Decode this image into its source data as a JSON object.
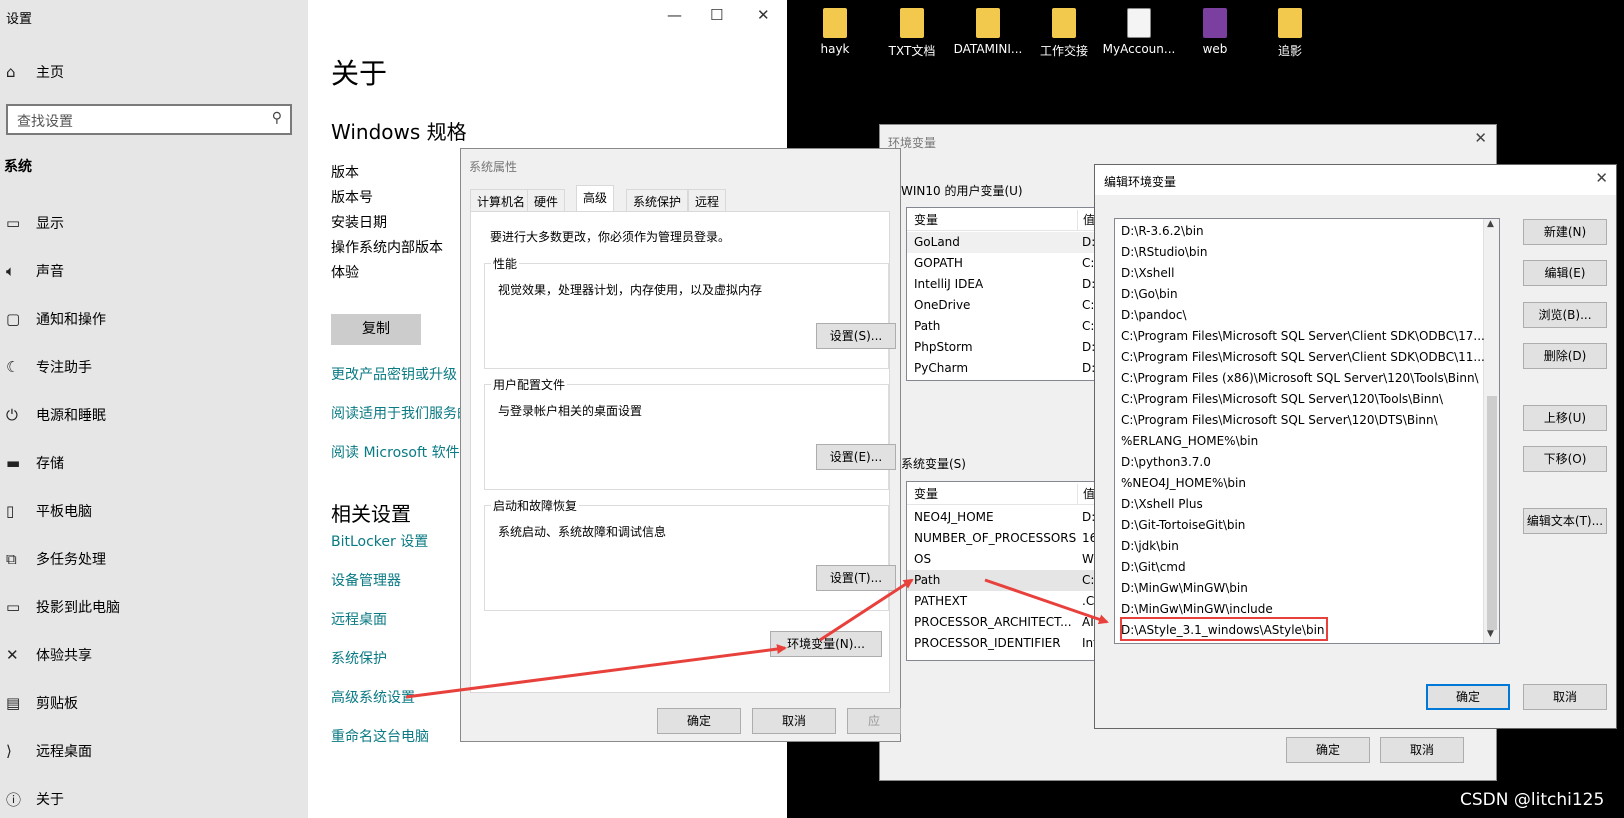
{
  "desktop": {
    "icons": [
      {
        "label": "hayk",
        "type": "folder"
      },
      {
        "label": "TXT文档",
        "type": "folder"
      },
      {
        "label": "DATAMINI...",
        "type": "folder"
      },
      {
        "label": "工作交接",
        "type": "folder"
      },
      {
        "label": "MyAccoun...",
        "type": "document"
      },
      {
        "label": "web",
        "type": "photoshop-file"
      },
      {
        "label": "追影",
        "type": "folder"
      }
    ],
    "watermark": "CSDN @litchi125"
  },
  "settings": {
    "window_title": "设置",
    "controls": {
      "minimize": "—",
      "maximize": "☐",
      "close": "✕"
    },
    "home": "主页",
    "search_placeholder": "查找设置",
    "section": "系统",
    "nav": [
      "显示",
      "声音",
      "通知和操作",
      "专注助手",
      "电源和睡眠",
      "存储",
      "平板电脑",
      "多任务处理",
      "投影到此电脑",
      "体验共享",
      "剪贴板",
      "远程桌面",
      "关于"
    ],
    "page_title": "关于",
    "spec_heading": "Windows 规格",
    "spec_labels": [
      "版本",
      "版本号",
      "安装日期",
      "操作系统内部版本",
      "体验"
    ],
    "copy_button": "复制",
    "links": [
      "更改产品密钥或升级",
      "阅读适用于我们服务的",
      "阅读 Microsoft 软件许"
    ],
    "related_heading": "相关设置",
    "related_links": [
      "BitLocker 设置",
      "设备管理器",
      "远程桌面",
      "系统保护",
      "高级系统设置",
      "重命名这台电脑"
    ]
  },
  "system_properties": {
    "title": "系统属性",
    "tabs": [
      "计算机名",
      "硬件",
      "高级",
      "系统保护",
      "远程"
    ],
    "active_tab": "高级",
    "admin_note": "要进行大多数更改，你必须作为管理员登录。",
    "performance": {
      "label": "性能",
      "desc": "视觉效果，处理器计划，内存使用，以及虚拟内存",
      "button": "设置(S)..."
    },
    "user_profiles": {
      "label": "用户配置文件",
      "desc": "与登录帐户相关的桌面设置",
      "button": "设置(E)..."
    },
    "startup": {
      "label": "启动和故障恢复",
      "desc": "系统启动、系统故障和调试信息",
      "button": "设置(T)..."
    },
    "env_button": "环境变量(N)...",
    "ok": "确定",
    "cancel": "取消",
    "apply": "应"
  },
  "env_vars": {
    "title": "环境变量",
    "user_group": "WIN10 的用户变量(U)",
    "header_var": "变量",
    "header_val": "值",
    "user_rows": [
      {
        "name": "GoLand",
        "value": "D:"
      },
      {
        "name": "GOPATH",
        "value": "C:\\"
      },
      {
        "name": "IntelliJ IDEA",
        "value": "D:"
      },
      {
        "name": "OneDrive",
        "value": "C:\\"
      },
      {
        "name": "Path",
        "value": "C:\\"
      },
      {
        "name": "PhpStorm",
        "value": "D:"
      },
      {
        "name": "PyCharm",
        "value": "D:"
      }
    ],
    "system_group": "系统变量(S)",
    "system_rows": [
      {
        "name": "NEO4J_HOME",
        "value": "D:"
      },
      {
        "name": "NUMBER_OF_PROCESSORS",
        "value": "16"
      },
      {
        "name": "OS",
        "value": "Wi"
      },
      {
        "name": "Path",
        "value": "C:\\"
      },
      {
        "name": "PATHEXT",
        "value": ".C("
      },
      {
        "name": "PROCESSOR_ARCHITECT...",
        "value": "AI"
      },
      {
        "name": "PROCESSOR_IDENTIFIER",
        "value": "Int"
      }
    ],
    "ok": "确定",
    "cancel": "取消"
  },
  "edit_env": {
    "title": "编辑环境变量",
    "entries": [
      "D:\\R-3.6.2\\bin",
      "D:\\RStudio\\bin",
      "D:\\Xshell",
      "D:\\Go\\bin",
      "D:\\pandoc\\",
      "C:\\Program Files\\Microsoft SQL Server\\Client SDK\\ODBC\\17...",
      "C:\\Program Files\\Microsoft SQL Server\\Client SDK\\ODBC\\11...",
      "C:\\Program Files (x86)\\Microsoft SQL Server\\120\\Tools\\Binn\\",
      "C:\\Program Files\\Microsoft SQL Server\\120\\Tools\\Binn\\",
      "C:\\Program Files\\Microsoft SQL Server\\120\\DTS\\Binn\\",
      "%ERLANG_HOME%\\bin",
      "D:\\python3.7.0",
      "%NEO4J_HOME%\\bin",
      "D:\\Xshell Plus",
      "D:\\Git-TortoiseGit\\bin",
      "D:\\jdk\\bin",
      "D:\\Git\\cmd",
      "D:\\MinGw\\MinGW\\bin",
      "D:\\MinGw\\MinGW\\include",
      "D:\\AStyle_3.1_windows\\AStyle\\bin"
    ],
    "highlighted_entry": "D:\\AStyle_3.1_windows\\AStyle\\bin",
    "buttons": [
      "新建(N)",
      "编辑(E)",
      "浏览(B)...",
      "删除(D)",
      "上移(U)",
      "下移(O)",
      "编辑文本(T)..."
    ],
    "ok": "确定",
    "cancel": "取消"
  },
  "colors": {
    "link": "#0a7a83",
    "annotation": "#e8413c",
    "accent": "#0078d7"
  }
}
